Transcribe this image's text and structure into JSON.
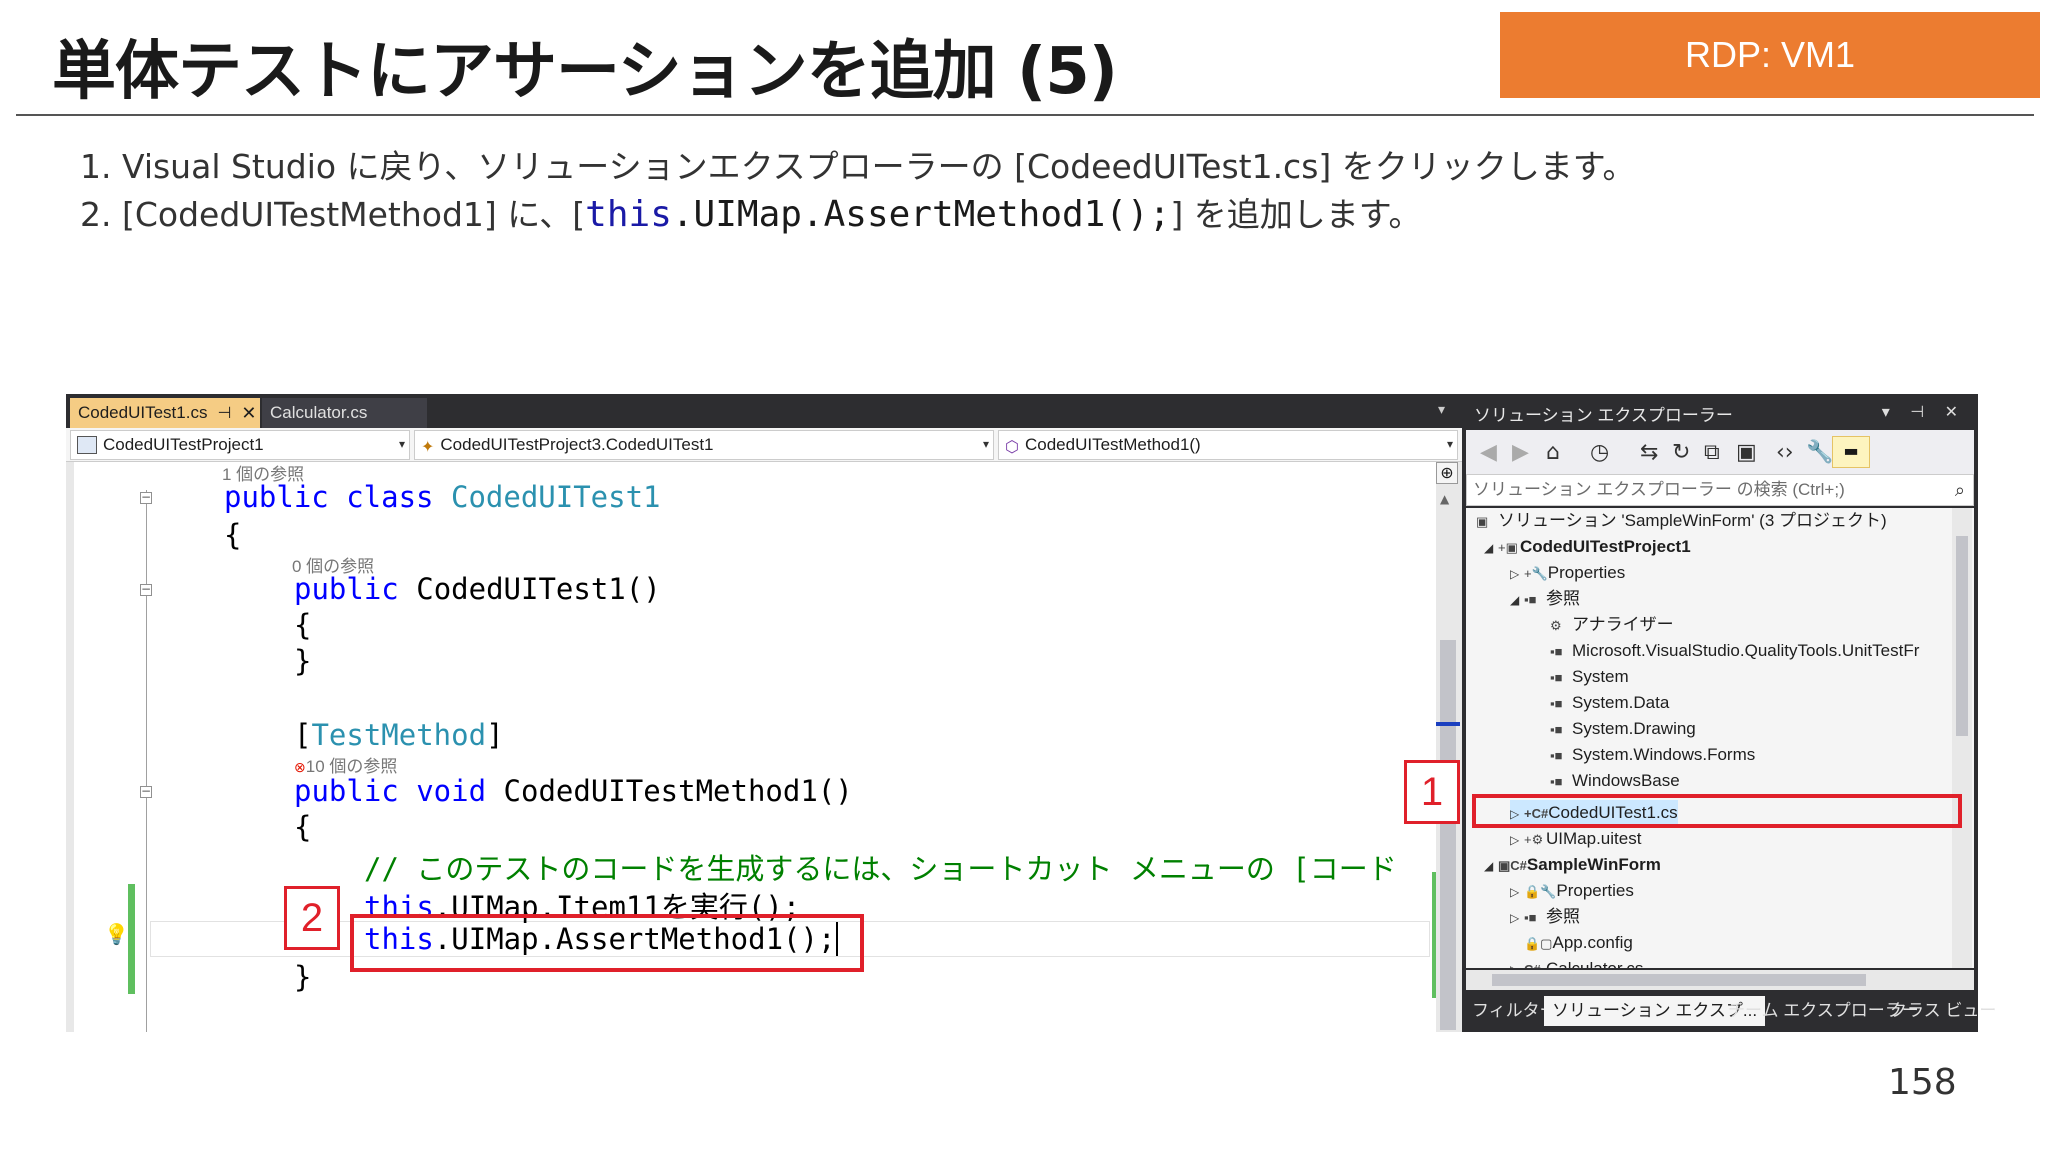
{
  "slide": {
    "title": "単体テストにアサーションを追加 (5)",
    "badge": "RDP: VM1",
    "page_number": "158",
    "steps": {
      "s1": "1.  Visual Studio に戻り、ソリューションエクスプローラーの [CodeedUITest1.cs] をクリックします。",
      "s2_prefix": "2.  [CodedUITestMethod1] に、[",
      "s2_code_kw": "this",
      "s2_code_rest": ".UIMap.AssertMethod1();",
      "s2_suffix": "] を追加します。"
    }
  },
  "vs": {
    "tabs": {
      "active": "CodedUITest1.cs",
      "pin": "⊣",
      "close": "✕",
      "inactive": "Calculator.cs"
    },
    "nav": {
      "project": "CodedUITestProject1",
      "class": "CodedUITestProject3.CodedUITest1",
      "method": "CodedUITestMethod1()"
    },
    "code": {
      "lens1": "1 個の参照",
      "l1_kw": "public class",
      "l1_ty": "CodedUITest1",
      "l2": "{",
      "lens2": "0 個の参照",
      "l3_kw": "public",
      "l3_rest": "CodedUITest1()",
      "l4": "{",
      "l5": "}",
      "l6_open": "[",
      "l6_ty": "TestMethod",
      "l6_close": "]",
      "lens3_err": "⊗",
      "lens3": "10 個の参照",
      "l7_kw": "public void",
      "l7_rest": "CodedUITestMethod1()",
      "l8": "{",
      "l9_cm": "// このテストのコードを生成するには、ショートカット メニューの [コード",
      "l10_kw": "this",
      "l10_rest": ".UIMap.Item11を実行();",
      "l11_kw": "this",
      "l11_rest": ".UIMap.AssertMethod1();",
      "l12": "}"
    },
    "callouts": {
      "label1": "1",
      "label2": "2"
    }
  },
  "solution_explorer": {
    "title": "ソリューション エクスプローラー",
    "title_icons": "▾ ⊣ ✕",
    "search_placeholder": "ソリューション エクスプローラー の検索 (Ctrl+;)",
    "tree": [
      {
        "label": "ソリューション 'SampleWinForm' (3 プロジェクト)",
        "icon": "solution-icon"
      },
      {
        "label": "CodedUITestProject1",
        "icon": "test-project-icon"
      },
      {
        "label": "Properties",
        "icon": "wrench-icon"
      },
      {
        "label": "参照",
        "icon": "references-icon"
      },
      {
        "label": "アナライザー",
        "icon": "analyzer-icon"
      },
      {
        "label": "Microsoft.VisualStudio.QualityTools.UnitTestFr",
        "icon": "reference-icon"
      },
      {
        "label": "System",
        "icon": "reference-icon"
      },
      {
        "label": "System.Data",
        "icon": "reference-icon"
      },
      {
        "label": "System.Drawing",
        "icon": "reference-icon"
      },
      {
        "label": "System.Windows.Forms",
        "icon": "reference-icon"
      },
      {
        "label": "WindowsBase",
        "icon": "reference-icon"
      },
      {
        "label": "CodedUITest1.cs",
        "icon": "csharp-file-icon"
      },
      {
        "label": "UIMap.uitest",
        "icon": "uitest-icon"
      },
      {
        "label": "SampleWinForm",
        "icon": "csharp-project-icon"
      },
      {
        "label": "Properties",
        "icon": "wrench-icon"
      },
      {
        "label": "参照",
        "icon": "references-icon"
      },
      {
        "label": "App.config",
        "icon": "config-icon"
      },
      {
        "label": "Calculator.cs",
        "icon": "csharp-file-icon"
      }
    ],
    "bottom_tabs": [
      "フィルター",
      "ソリューション エクスプ...",
      "チーム エクスプローラー",
      "クラス ビュー"
    ]
  },
  "colors": {
    "badge": "#ec7c30",
    "callout_red": "#e0202a",
    "keyword_blue": "#0000ff",
    "type_teal": "#2b91af",
    "comment_green": "#008000"
  }
}
